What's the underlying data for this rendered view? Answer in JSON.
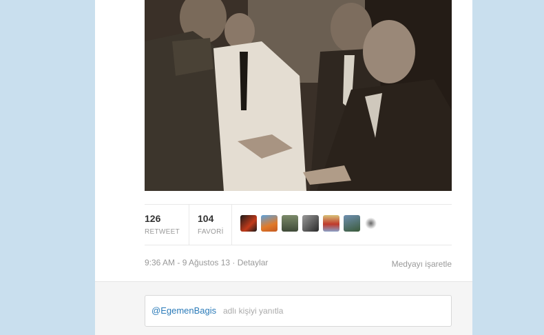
{
  "tweet": {
    "stats": {
      "retweets": "126",
      "retweets_label": "RETWEET",
      "favorites": "104",
      "favorites_label": "FAVORİ"
    },
    "timestamp": "9:36 AM - 9 Ağustos 13 · Detaylar",
    "flag_media": "Medyayı işaretle"
  },
  "reply": {
    "handle": "@EgemenBagis",
    "hint": "adlı kişiyi yanıtla"
  },
  "colors": {
    "background": "#c9dfee",
    "link": "#2b7bb9"
  }
}
